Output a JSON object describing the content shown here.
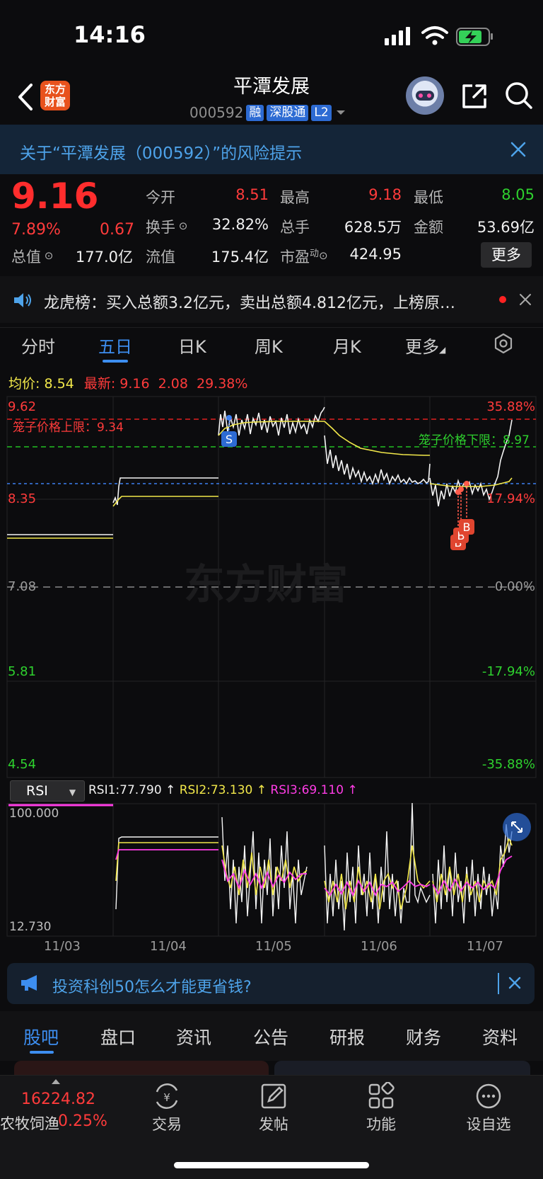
{
  "status_bar": {
    "time": "14:16"
  },
  "header": {
    "logo_text": "东方财富",
    "stock_name": "平潭发展",
    "stock_code": "000592",
    "tags": [
      "融",
      "深股通",
      "L2"
    ]
  },
  "risk_banner": {
    "text": "关于“平潭发展（000592）”的风险提示"
  },
  "quote": {
    "price": "9.16",
    "change_pct": "7.89%",
    "change": "0.67",
    "fields": [
      {
        "label": "今开",
        "value": "8.51",
        "color": "red"
      },
      {
        "label": "最高",
        "value": "9.18",
        "color": "red"
      },
      {
        "label": "最低",
        "value": "8.05",
        "color": "green"
      },
      {
        "label": "换手",
        "value": "32.82%",
        "color": "white"
      },
      {
        "label": "总手",
        "value": "628.5万",
        "color": "white"
      },
      {
        "label": "金额",
        "value": "53.69亿",
        "color": "white"
      },
      {
        "label": "总值",
        "value": "177.0亿",
        "color": "white"
      },
      {
        "label": "流值",
        "value": "175.4亿",
        "color": "white"
      },
      {
        "label": "市盈",
        "label_sup": "动",
        "value": "424.95",
        "color": "white"
      }
    ],
    "more_label": "更多"
  },
  "lhb": {
    "text": "龙虎榜：买入总额3.2亿元，卖出总额4.812亿元，上榜原…"
  },
  "chart_tabs": [
    "分时",
    "五日",
    "日K",
    "周K",
    "月K",
    "更多"
  ],
  "chart_tabs_active": "五日",
  "legend": {
    "avg_label": "均价:",
    "avg_value": "8.54",
    "latest_label": "最新:",
    "latest_value": "9.16",
    "latest_change": "2.08",
    "latest_pct": "29.38%"
  },
  "watermark": "东方财富",
  "price_chart": {
    "left_labels": [
      "9.62",
      "8.35",
      "7.08",
      "5.81",
      "4.54"
    ],
    "right_labels": [
      "35.88%",
      "17.94%",
      "0.00%",
      "-17.94%",
      "-35.88%"
    ],
    "cage_upper_label": "笼子价格上限：9.34",
    "cage_lower_label": "笼子价格下限：8.97",
    "marker_s": "S",
    "marker_b": "B"
  },
  "chart_data": {
    "type": "line",
    "title": "",
    "x": [
      "11/03",
      "11/04",
      "11/05",
      "11/06",
      "11/07"
    ],
    "ylim": [
      4.54,
      9.62
    ],
    "prev_close": 7.08,
    "series": [
      {
        "name": "最新",
        "color": "#ffffff",
        "values": [
          7.55,
          8.6,
          9.5,
          8.6,
          9.16
        ]
      },
      {
        "name": "均价",
        "color": "#f2e84a",
        "values": [
          7.51,
          8.42,
          9.33,
          8.8,
          8.54
        ]
      }
    ],
    "reference_lines": [
      {
        "name": "笼子价格上限",
        "value": 9.34,
        "color": "#ff2d2d"
      },
      {
        "name": "笼子价格下限",
        "value": 8.97,
        "color": "#2ed12e"
      }
    ]
  },
  "rsi": {
    "selector": "RSI",
    "rsi1": "RSI1:77.790 ↑",
    "rsi2": "RSI2:73.130 ↑",
    "rsi3": "RSI3:69.110 ↑",
    "top_label": "100.000",
    "bottom_label": "12.730"
  },
  "date_axis": [
    "11/03",
    "11/04",
    "11/05",
    "11/06",
    "11/07"
  ],
  "ad": {
    "text": "投资科创50怎么才能更省钱?"
  },
  "section_tabs": [
    "股吧",
    "盘口",
    "资讯",
    "公告",
    "研报",
    "财务",
    "资料"
  ],
  "bottom_nav": {
    "index_value": "16224.82",
    "index_name": "农牧饲渔",
    "index_pct": "0.25%",
    "items": [
      "交易",
      "发帖",
      "功能",
      "设自选"
    ]
  }
}
